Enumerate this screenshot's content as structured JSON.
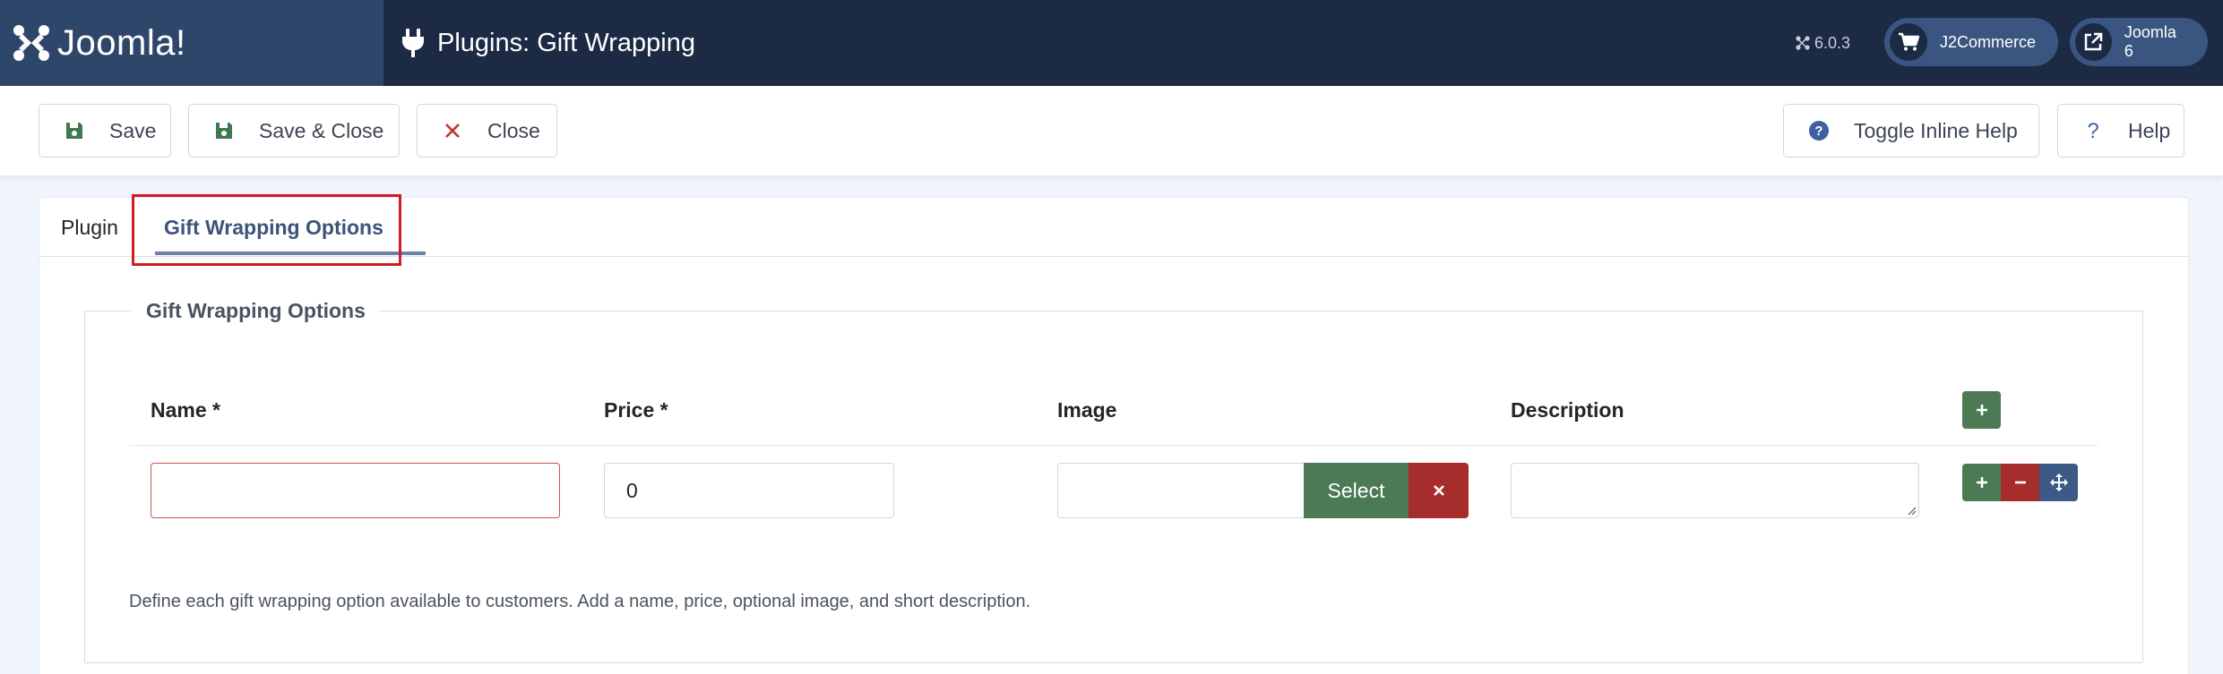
{
  "header": {
    "brand": "Joomla!",
    "title": "Plugins: Gift Wrapping",
    "version": "6.0.3",
    "links": [
      {
        "label": "J2Commerce",
        "icon": "cart-icon"
      },
      {
        "label": "Joomla 6",
        "icon": "external-link-icon"
      }
    ]
  },
  "toolbar": {
    "save_label": "Save",
    "save_close_label": "Save & Close",
    "close_label": "Close",
    "inline_help_label": "Toggle Inline Help",
    "help_label": "Help"
  },
  "tabs": [
    {
      "label": "Plugin",
      "active": false
    },
    {
      "label": "Gift Wrapping Options",
      "active": true
    }
  ],
  "fieldset": {
    "legend": "Gift Wrapping Options",
    "columns": [
      "Name *",
      "Price *",
      "Image",
      "Description"
    ],
    "row": {
      "name_value": "",
      "price_value": "0",
      "image_value": "",
      "description_value": ""
    },
    "select_label": "Select",
    "help_text": "Define each gift wrapping option available to customers. Add a name, price, optional image, and short description."
  },
  "colors": {
    "header_bg": "#1c2a44",
    "logo_bg": "#2f466b",
    "success": "#4c7a54",
    "danger": "#a72d2c",
    "primary": "#3d5a87",
    "highlight": "#d21c24"
  }
}
